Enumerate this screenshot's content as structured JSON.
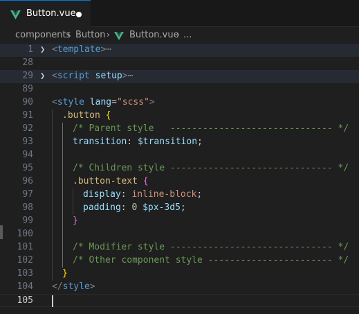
{
  "tab": {
    "filename": "Button.vue",
    "modified_indicator": "unsaved-dot"
  },
  "breadcrumb": {
    "folder": "components",
    "subfolder": "Button",
    "file": "Button.vue",
    "more": "..."
  },
  "editor": {
    "line_numbers": [
      "1",
      "28",
      "29",
      "89",
      "90",
      "91",
      "92",
      "93",
      "94",
      "95",
      "96",
      "97",
      "98",
      "99",
      "100",
      "101",
      "102",
      "103",
      "104",
      "105"
    ],
    "l1": {
      "open": "<",
      "tag": "template",
      "close": ">",
      "ellipsis": "⋯"
    },
    "l29": {
      "open": "<",
      "tag": "script",
      "attr": "setup",
      "close": ">",
      "ellipsis": "⋯"
    },
    "l90": {
      "open": "<",
      "tag": "style",
      "attr": "lang",
      "eq": "=",
      "value": "\"scss\"",
      "close": ">"
    },
    "l91": {
      "selector": ".button",
      "brace": "{"
    },
    "l92": {
      "comment": "/* Parent style   ------------------------------ */"
    },
    "l93": {
      "property": "transition",
      "colon": ": ",
      "value": "$transition",
      "semi": ";"
    },
    "l95": {
      "comment": "/* Children style ------------------------------ */"
    },
    "l96": {
      "selector": ".button-text",
      "brace": "{"
    },
    "l97": {
      "property": "display",
      "colon": ": ",
      "value": "inline-block",
      "semi": ";"
    },
    "l98": {
      "property": "padding",
      "colon": ": ",
      "num": "0",
      "value": "$px-3d5",
      "semi": ";"
    },
    "l99": {
      "brace": "}"
    },
    "l101": {
      "comment": "/* Modifier style ------------------------------ */"
    },
    "l102": {
      "comment": "/* Other component style ----------------------- */"
    },
    "l103": {
      "brace": "}"
    },
    "l104": {
      "open": "</",
      "tag": "style",
      "close": ">"
    }
  },
  "colors": {
    "accent": "#0078d4",
    "vue_green": "#41b883"
  }
}
